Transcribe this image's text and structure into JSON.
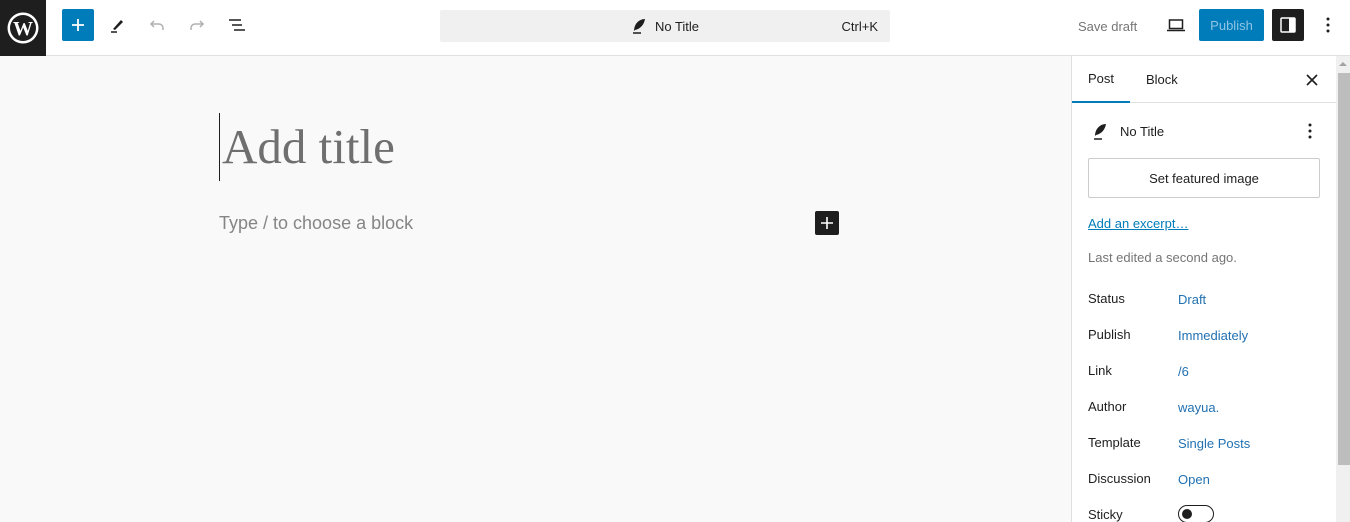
{
  "header": {
    "logo_letter": "W",
    "add_block_label": "+",
    "command_bar": {
      "title": "No Title",
      "shortcut": "Ctrl+K"
    },
    "save_draft_label": "Save draft",
    "publish_label": "Publish"
  },
  "canvas": {
    "title_placeholder": "Add title",
    "block_placeholder": "Type / to choose a block",
    "inline_add_label": "+"
  },
  "sidebar": {
    "tabs": [
      {
        "label": "Post",
        "active": true
      },
      {
        "label": "Block",
        "active": false
      }
    ],
    "close_label": "✕",
    "post_title": "No Title",
    "featured_image_label": "Set featured image",
    "excerpt_link": "Add an excerpt…",
    "last_edited": "Last edited a second ago.",
    "meta": [
      {
        "label": "Status",
        "value": "Draft"
      },
      {
        "label": "Publish",
        "value": "Immediately"
      },
      {
        "label": "Link",
        "value": "/6"
      },
      {
        "label": "Author",
        "value": "wayua."
      },
      {
        "label": "Template",
        "value": "Single Posts"
      },
      {
        "label": "Discussion",
        "value": "Open"
      }
    ],
    "sticky": {
      "label": "Sticky",
      "enabled": false
    }
  },
  "colors": {
    "accent": "#007cba",
    "dark": "#1e1e1e",
    "link": "#2271b1"
  }
}
